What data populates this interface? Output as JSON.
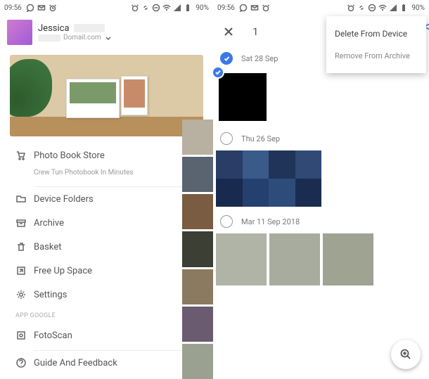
{
  "status": {
    "time": "09:56",
    "battery": "90%"
  },
  "left": {
    "user_name": "Jessica",
    "email_domain": "Domail.com",
    "promo_title": "Photo Book Store",
    "promo_sub": "Crew Tun Photobook In Minutes",
    "items": {
      "device_folders": "Device Folders",
      "archive": "Archive",
      "basket": "Basket",
      "free_up": "Free Up Space",
      "settings": "Settings"
    },
    "section": "APP GOOGLE",
    "fotoscan": "FotoScan",
    "guide": "Guide And Feedback"
  },
  "right": {
    "selected_count": "1",
    "menu": {
      "delete": "Delete From Device",
      "remove_archive": "Remove From Archive"
    },
    "groups": [
      {
        "label": "Sat 28 Sep",
        "checked": true
      },
      {
        "label": "Thu 26 Sep",
        "checked": false
      },
      {
        "label": "Mar 11 Sep 2018",
        "checked": false
      }
    ]
  }
}
